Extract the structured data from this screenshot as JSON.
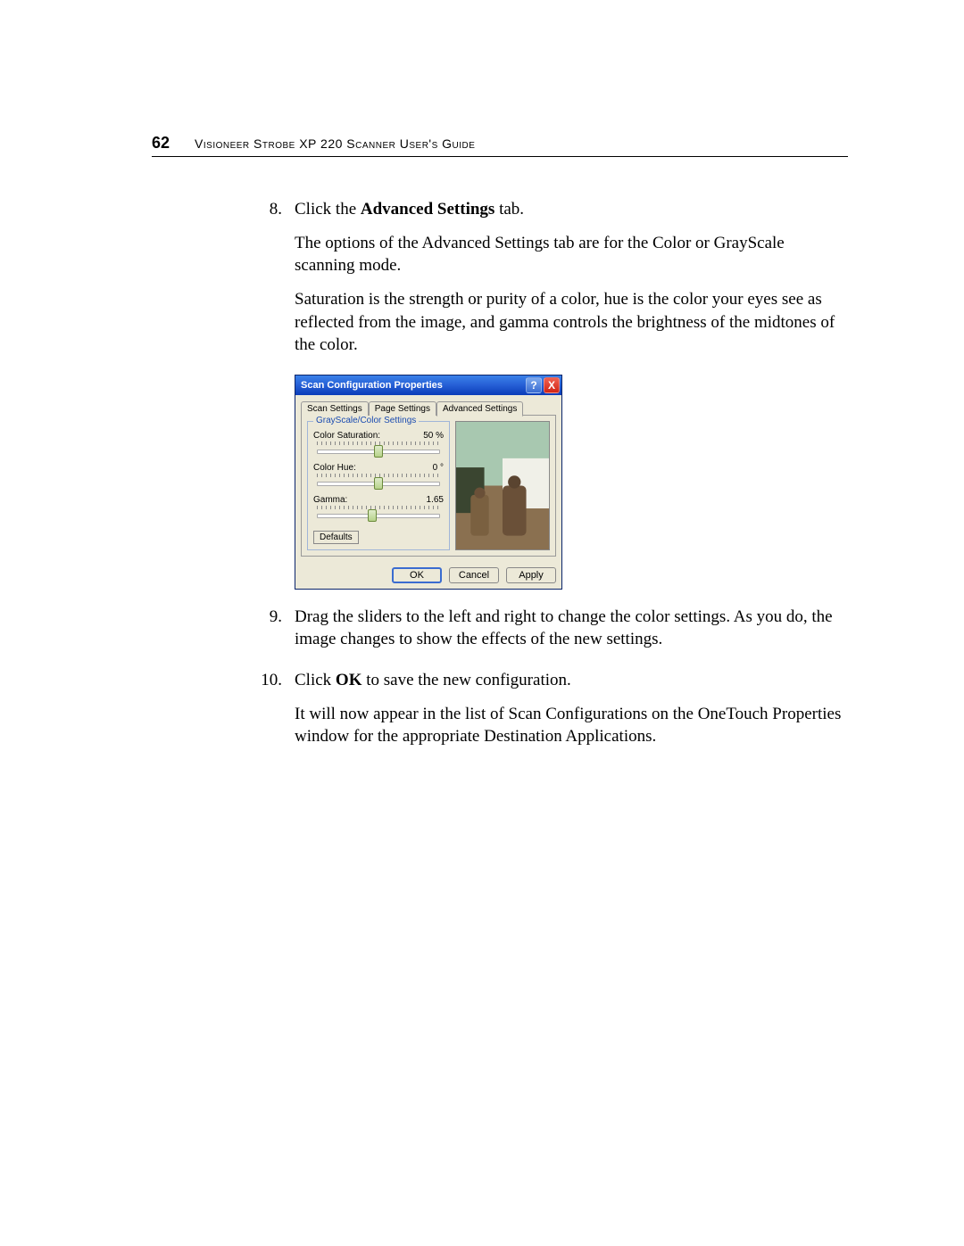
{
  "header": {
    "page_number": "62",
    "doc_title": "Visioneer Strobe XP 220 Scanner User's Guide"
  },
  "steps": {
    "s8": {
      "num": "8.",
      "line1_prefix": "Click the ",
      "line1_bold": "Advanced Settings",
      "line1_suffix": " tab.",
      "para2": "The options of the Advanced Settings tab are for the Color or GrayScale scanning mode.",
      "para3": "Saturation is the strength or purity of a color, hue is the color your eyes see as reflected from the image, and gamma controls the brightness of the midtones of the color."
    },
    "s9": {
      "num": "9.",
      "text": "Drag the sliders to the left and right to change the color settings. As you do, the image changes to show the effects of the new settings."
    },
    "s10": {
      "num": "10.",
      "line1_prefix": "Click ",
      "line1_bold": "OK",
      "line1_suffix": " to save the new configuration.",
      "para2": "It will now appear in the list of Scan Configurations on the OneTouch Properties window for the appropriate Destination Applications."
    }
  },
  "dialog": {
    "title": "Scan Configuration Properties",
    "help_glyph": "?",
    "close_glyph": "X",
    "tabs": {
      "t1": "Scan Settings",
      "t2": "Page Settings",
      "t3": "Advanced Settings"
    },
    "fieldset_legend": "GrayScale/Color Settings",
    "sliders": {
      "saturation": {
        "label": "Color Saturation:",
        "value": "50 %",
        "pos": 50
      },
      "hue": {
        "label": "Color Hue:",
        "value": "0 °",
        "pos": 50
      },
      "gamma": {
        "label": "Gamma:",
        "value": "1.65",
        "pos": 45
      }
    },
    "defaults": "Defaults",
    "buttons": {
      "ok": "OK",
      "cancel": "Cancel",
      "apply": "Apply"
    }
  }
}
